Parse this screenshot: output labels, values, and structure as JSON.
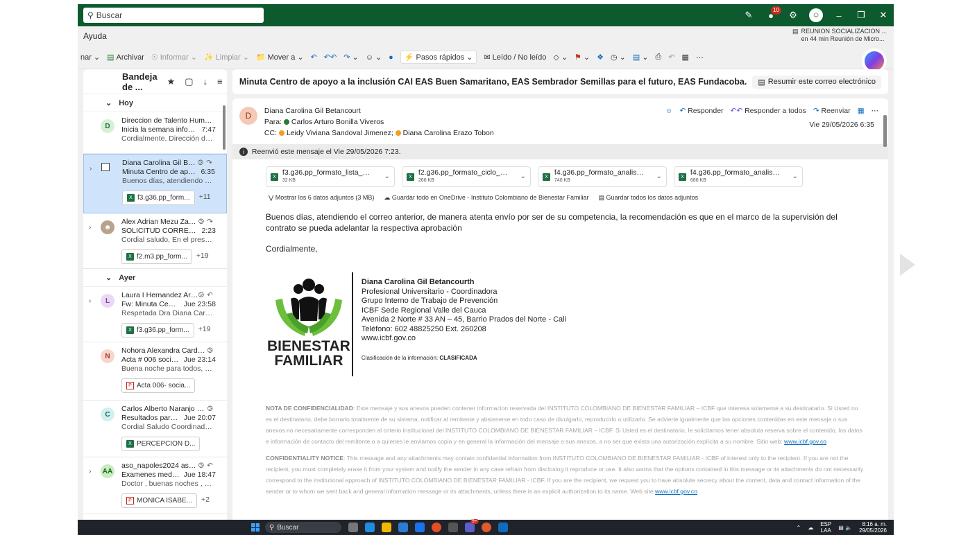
{
  "titlebar": {
    "search_placeholder": "Buscar",
    "notif_count": "10"
  },
  "menubar": {
    "help": "Ayuda",
    "meeting_title": "REUNION SOCIALIZACION ...",
    "meeting_time": "en 44 min Reunión de Micro..."
  },
  "ribbon": {
    "cut": "nar",
    "archive": "Archivar",
    "report": "Informar",
    "clean": "Limpiar",
    "move": "Mover a",
    "quick_steps": "Pasos rápidos",
    "read_unread": "Leído / No leído"
  },
  "list": {
    "folder": "Bandeja de ...",
    "group_today": "Hoy",
    "group_yesterday": "Ayer",
    "items": [
      {
        "initial": "D",
        "sender": "Direccion de Talento Humano",
        "subject": "Inicia la semana informado >...",
        "time": "7:47",
        "preview": "Cordialmente, Dirección de Talento ..."
      },
      {
        "sender": "Diana Carolina Gil Betanco...",
        "subject": "Minuta Centro de apoyo a la i...",
        "time": "6:35",
        "preview": "Buenos días, atendiendo el correo a...",
        "attachment": "f3.g36.pp_form...",
        "more": "+11"
      },
      {
        "sender": "Alex Adrian Mezu Zamora; ...",
        "subject": "SOLICITUD CORRECION EN EL...",
        "time": "2:23",
        "preview": "Cordial saludo, En el presente me pe...",
        "attachment": "f2.m3.pp_form...",
        "more": "+19"
      },
      {
        "initial": "L",
        "sender": "Laura I Hernandez Arrieta; ...",
        "subject": "Fw: Minuta Centro de apo...",
        "time": "Jue 23:58",
        "preview": "Respetada Dra Diana Carolina Gil, C...",
        "attachment": "f3.g36.pp_form...",
        "more": "+19"
      },
      {
        "initial": "N",
        "sender": "Nohora Alexandra Cardona Lo...",
        "subject": "Acta # 006 socialización v...",
        "time": "Jue 23:14",
        "preview": "Buena noche para todos, cordial sal...",
        "attachment": "Acta 006- socia..."
      },
      {
        "initial": "C",
        "sender": "Carlos Alberto Naranjo Borrero",
        "subject": "Resultados parciales encu...",
        "time": "Jue 20:07",
        "preview": "Cordial Saludo Coordinadores y Sup...",
        "attachment": "PERCEPCION D..."
      },
      {
        "initial": "AA",
        "sender": "aso_napoles2024 asociacion",
        "subject": "Examenes medicos - Pen...",
        "time": "Jue 18:47",
        "preview": "Doctor , buenas noches , en correos ...",
        "attachment": "MONICA ISABE...",
        "more": "+2"
      }
    ]
  },
  "reading": {
    "subject": "Minuta Centro de apoyo a la inclusión CAI EAS Buen Samaritano, EAS Sembrador Semillas para el futuro, EAS Fundacoba.",
    "summarize": "Resumir este correo electrónico",
    "from": "Diana Carolina Gil Betancourt",
    "avatar": "D",
    "to_label": "Para:",
    "to": "Carlos Arturo Bonilla Viveros",
    "cc_label": "CC:",
    "cc1": "Leidy Viviana Sandoval Jimenez;",
    "cc2": "Diana Carolina Erazo Tobon",
    "reply": "Responder",
    "reply_all": "Responder a todos",
    "forward": "Reenviar",
    "date": "Vie 29/05/2026 6:35",
    "forwarded": "Reenvió este mensaje el Vie 29/05/2026 7:23.",
    "attachments": [
      {
        "name": "f3.g36.pp_formato_lista_de_i...",
        "size": "32 KB"
      },
      {
        "name": "f2.g36.pp_formato_ciclo_de_...",
        "size": "266 KB"
      },
      {
        "name": "f4.g36.pp_formato_analisis_d...",
        "size": "740 KB"
      },
      {
        "name": "f4.g36.pp_formato_analisis_d...",
        "size": "686 KB"
      }
    ],
    "show_all": "Mostrar los 6 datos adjuntos (3 MB)",
    "save_onedrive": "Guardar todo en OneDrive - Instituto Colombiano de Bienestar Familiar",
    "save_all": "Guardar todos los datos adjuntos",
    "body_p1": "Buenos días, atendiendo el correo anterior, de manera atenta envío por ser de su competencia, la recomendación es que en el marco de la supervisión del contrato se pueda adelantar la respectiva aprobación",
    "body_p2": "Cordialmente,",
    "logo_line1": "BIENESTAR",
    "logo_line2": "FAMILIAR",
    "sig": {
      "name": "Diana Carolina Gil Betancourth",
      "l1": "Profesional Universitario - Coordinadora",
      "l2": "Grupo Interno de Trabajo de Prevención",
      "l3": "ICBF Sede Regional Valle del Cauca",
      "l4": "Avenida 2 Norte # 33 AN – 45, Barrio Prados del Norte - Cali",
      "l5": "Teléfono: 602 48825250 Ext. 260208",
      "l6": "www.icbf.gov.co",
      "clasif_label": "Clasificación de la información:",
      "clasif_value": "CLASIFICADA"
    },
    "nota_label": "NOTA DE CONFIDENCIALIDAD",
    "nota_text": ": Este mensaje y sus anexos pueden contener informacion reservada del INSTITUTO COLOMBIANO DE BIENESTAR FAMILIAR – ICBF que interesa solamente a su destinatario. Si Usted no es el destinatario, debe borrarlo totalmente de su sistema, notificar al remitente y abstenerse en todo caso de divulgarlo, reproducirlo o utilizarlo. Se advierte igualmente que las opciones contenidas en este mensaje o sus anexos no necesariamente corresponden al criterio institucional del INSTITUTO COLOMBIANO DE BIENESTAR FAMILIAR – ICBF. Si Usted es el destinatario, le solicitamos tener absoluta reserva sobre el contenido, los datos e información de contacto del remitente o a quienes le enviamos copia y en general la información del mensaje o sus anexos, a no ser que exista una autorización explícita a su nombre. Sitio web:",
    "nota_link": "www.icbf.gov.co",
    "conf_label": "CONFIDENTIALITY NOTICE",
    "conf_text": ": This message and any attachments may contain confidential information from INSTITUTO COLOMBIANO DE BIENESTAR FAMILIAR - ICBF of interest only to the recipient. If you are not the recipient, you must completely erase it from your system and notify the sender in any case refrain from disclosing it reproduce or use. It also warns that the options contained in this message or its attachments do not necessarily correspond to the institutional approach of INSTITUTO COLOMBIANO DE BIENESTAR FAMILIAR - ICBF. If you are the recipient, we request you to have absolute secrecy about the content, data and contact information of the sender or to whom we sent back and general information message or its attachments, unless there is an explicit authorization to its name. Web site:",
    "conf_link": "www.icbf.gov.co"
  },
  "taskbar": {
    "search": "Buscar",
    "lang1": "ESP",
    "lang2": "LAA",
    "time": "8:16 a. m.",
    "date": "29/05/2026",
    "badge": "9+"
  }
}
